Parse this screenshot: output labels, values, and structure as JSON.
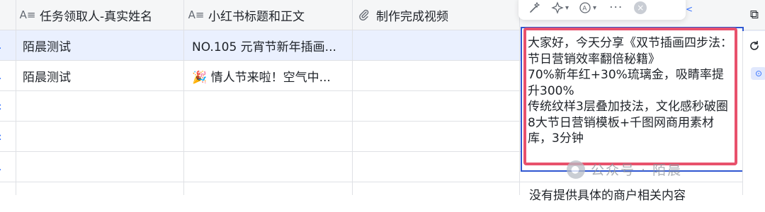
{
  "columns": [
    {
      "icon": "A≡",
      "label": "任务领取人-真实姓名"
    },
    {
      "icon": "A≡",
      "label": "小红书标题和正文"
    },
    {
      "icon": "⌀",
      "label": "制作完成视频"
    }
  ],
  "rows": [
    {
      "index_marker": ".",
      "name": "陌晨测试",
      "title": "NO.105 元宵节新年插画...",
      "selected": true
    },
    {
      "index_marker": ".",
      "name": "陌晨测试",
      "title": "🎉 情人节来啦！空气中...",
      "selected": false
    },
    {
      "index_marker": ":",
      "name": "",
      "title": "",
      "selected": false
    },
    {
      "index_marker": ":",
      "name": "",
      "title": "",
      "selected": false
    },
    {
      "index_marker": ".",
      "name": "",
      "title": "",
      "selected": false
    },
    {
      "index_marker": "",
      "name": "",
      "title": "",
      "selected": false
    }
  ],
  "toolbar": {
    "items": [
      "magic-pen-icon",
      "sparkle-icon",
      "translate-icon",
      "more-icon",
      "close-icon"
    ],
    "more": "···",
    "close": "×",
    "arrow": "<"
  },
  "editor": {
    "text": "大家好，今天分享《双节插画四步法：节日营销效率翻倍秘籍》\n70%新年红+30%琉璃金，吸睛率提升300%\n传统纹样3层叠加技法，文化感秒破圈\n8大节日营销模板+千图网商用素材库，3分钟"
  },
  "below_text": "没有提供具体的商户相关内容",
  "watermark": "公众号 · 陌晨",
  "right_buttons": {
    "copy": "⧉",
    "refresh": "C",
    "badge": "⊙"
  },
  "colors": {
    "accent": "#3370ff",
    "highlight": "#e8516c",
    "selected_row": "#eaf0fe"
  }
}
